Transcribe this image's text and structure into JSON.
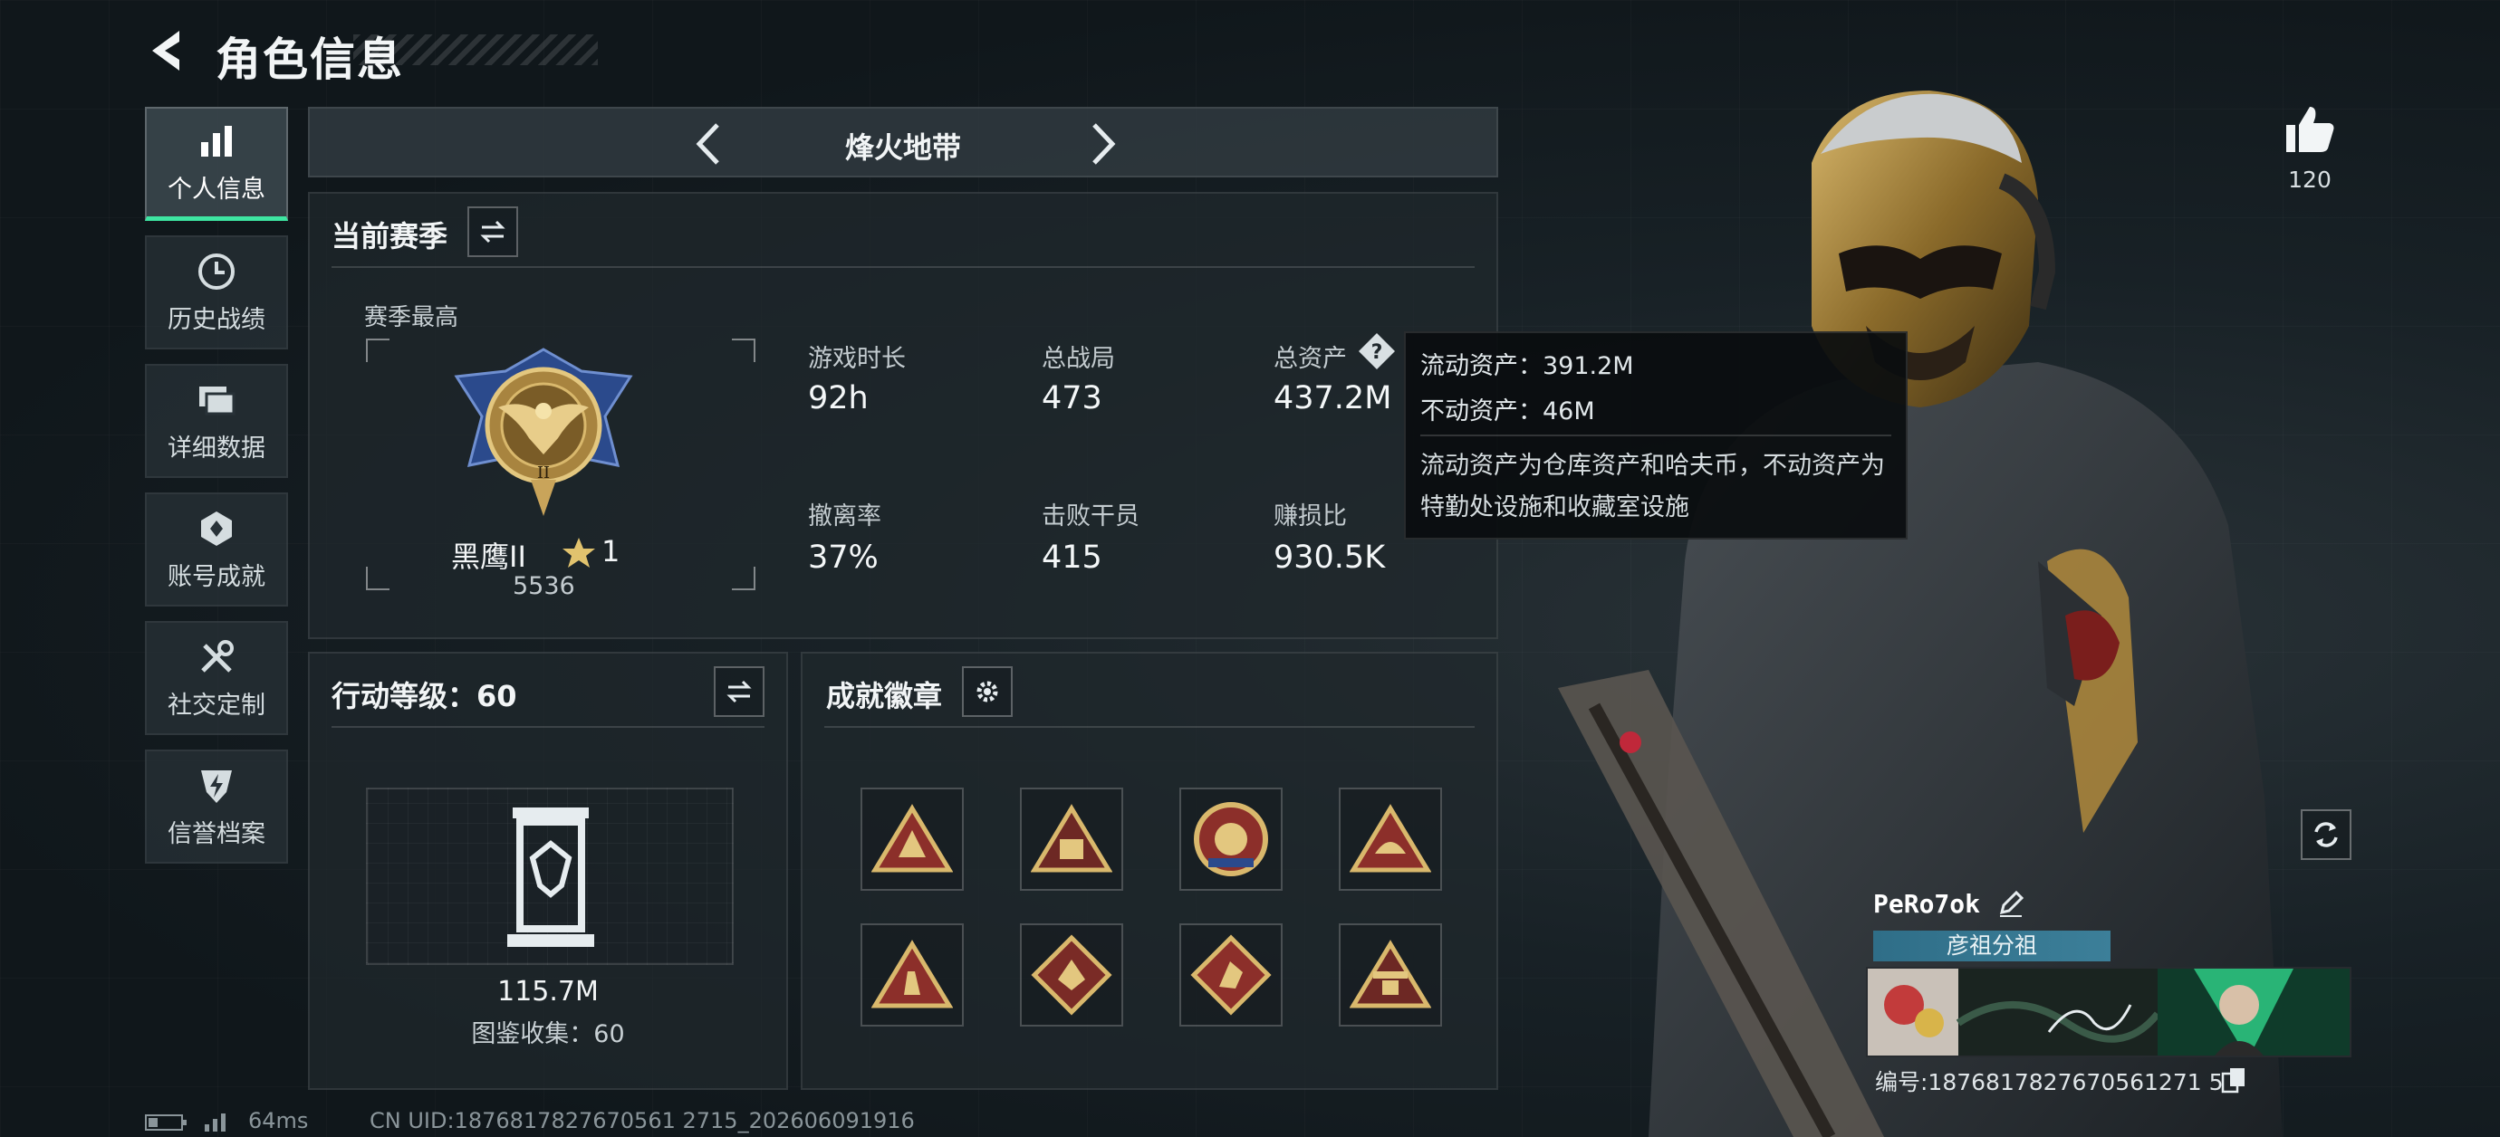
{
  "header": {
    "title": "角色信息"
  },
  "sidebar": {
    "items": [
      {
        "label": "个人信息",
        "icon": "bar-chart-icon",
        "active": true
      },
      {
        "label": "历史战绩",
        "icon": "clock-icon"
      },
      {
        "label": "详细数据",
        "icon": "folders-icon"
      },
      {
        "label": "账号成就",
        "icon": "medal-icon"
      },
      {
        "label": "社交定制",
        "icon": "tools-icon"
      },
      {
        "label": "信誉档案",
        "icon": "shield-lightning-icon"
      }
    ]
  },
  "mode": {
    "name": "烽火地带"
  },
  "season": {
    "title": "当前赛季",
    "best_label": "赛季最高",
    "rank_name": "黑鹰II",
    "rank_stars": "1",
    "rank_score": "5536",
    "stats": [
      {
        "label": "游戏时长",
        "value": "92h"
      },
      {
        "label": "总战局",
        "value": "473"
      },
      {
        "label": "总资产",
        "value": "437.2M"
      },
      {
        "label": "撤离率",
        "value": "37%"
      },
      {
        "label": "击败干员",
        "value": "415"
      },
      {
        "label": "赚损比",
        "value": "930.5K"
      }
    ]
  },
  "tooltip": {
    "liquid": "流动资产：391.2M",
    "fixed": "不动资产：46M",
    "note": "流动资产为仓库资产和哈夫币，不动资产为特勤处设施和收藏室设施"
  },
  "level": {
    "title": "行动等级：60",
    "value": "115.7M",
    "collection": "图鉴收集：60"
  },
  "badges": {
    "title": "成就徽章",
    "count": 8
  },
  "profile": {
    "likes": "120",
    "name": "PeRo7ok",
    "group": "彦祖分祖",
    "id": "编号:1876817827670561271 5"
  },
  "status": {
    "ping": "64ms",
    "uid": "CN UID:1876817827670561 2715_202606091916"
  },
  "colors": {
    "accent": "#3ee5a2",
    "gold": "#c9a45a",
    "badge_red": "#8c2f2a"
  }
}
